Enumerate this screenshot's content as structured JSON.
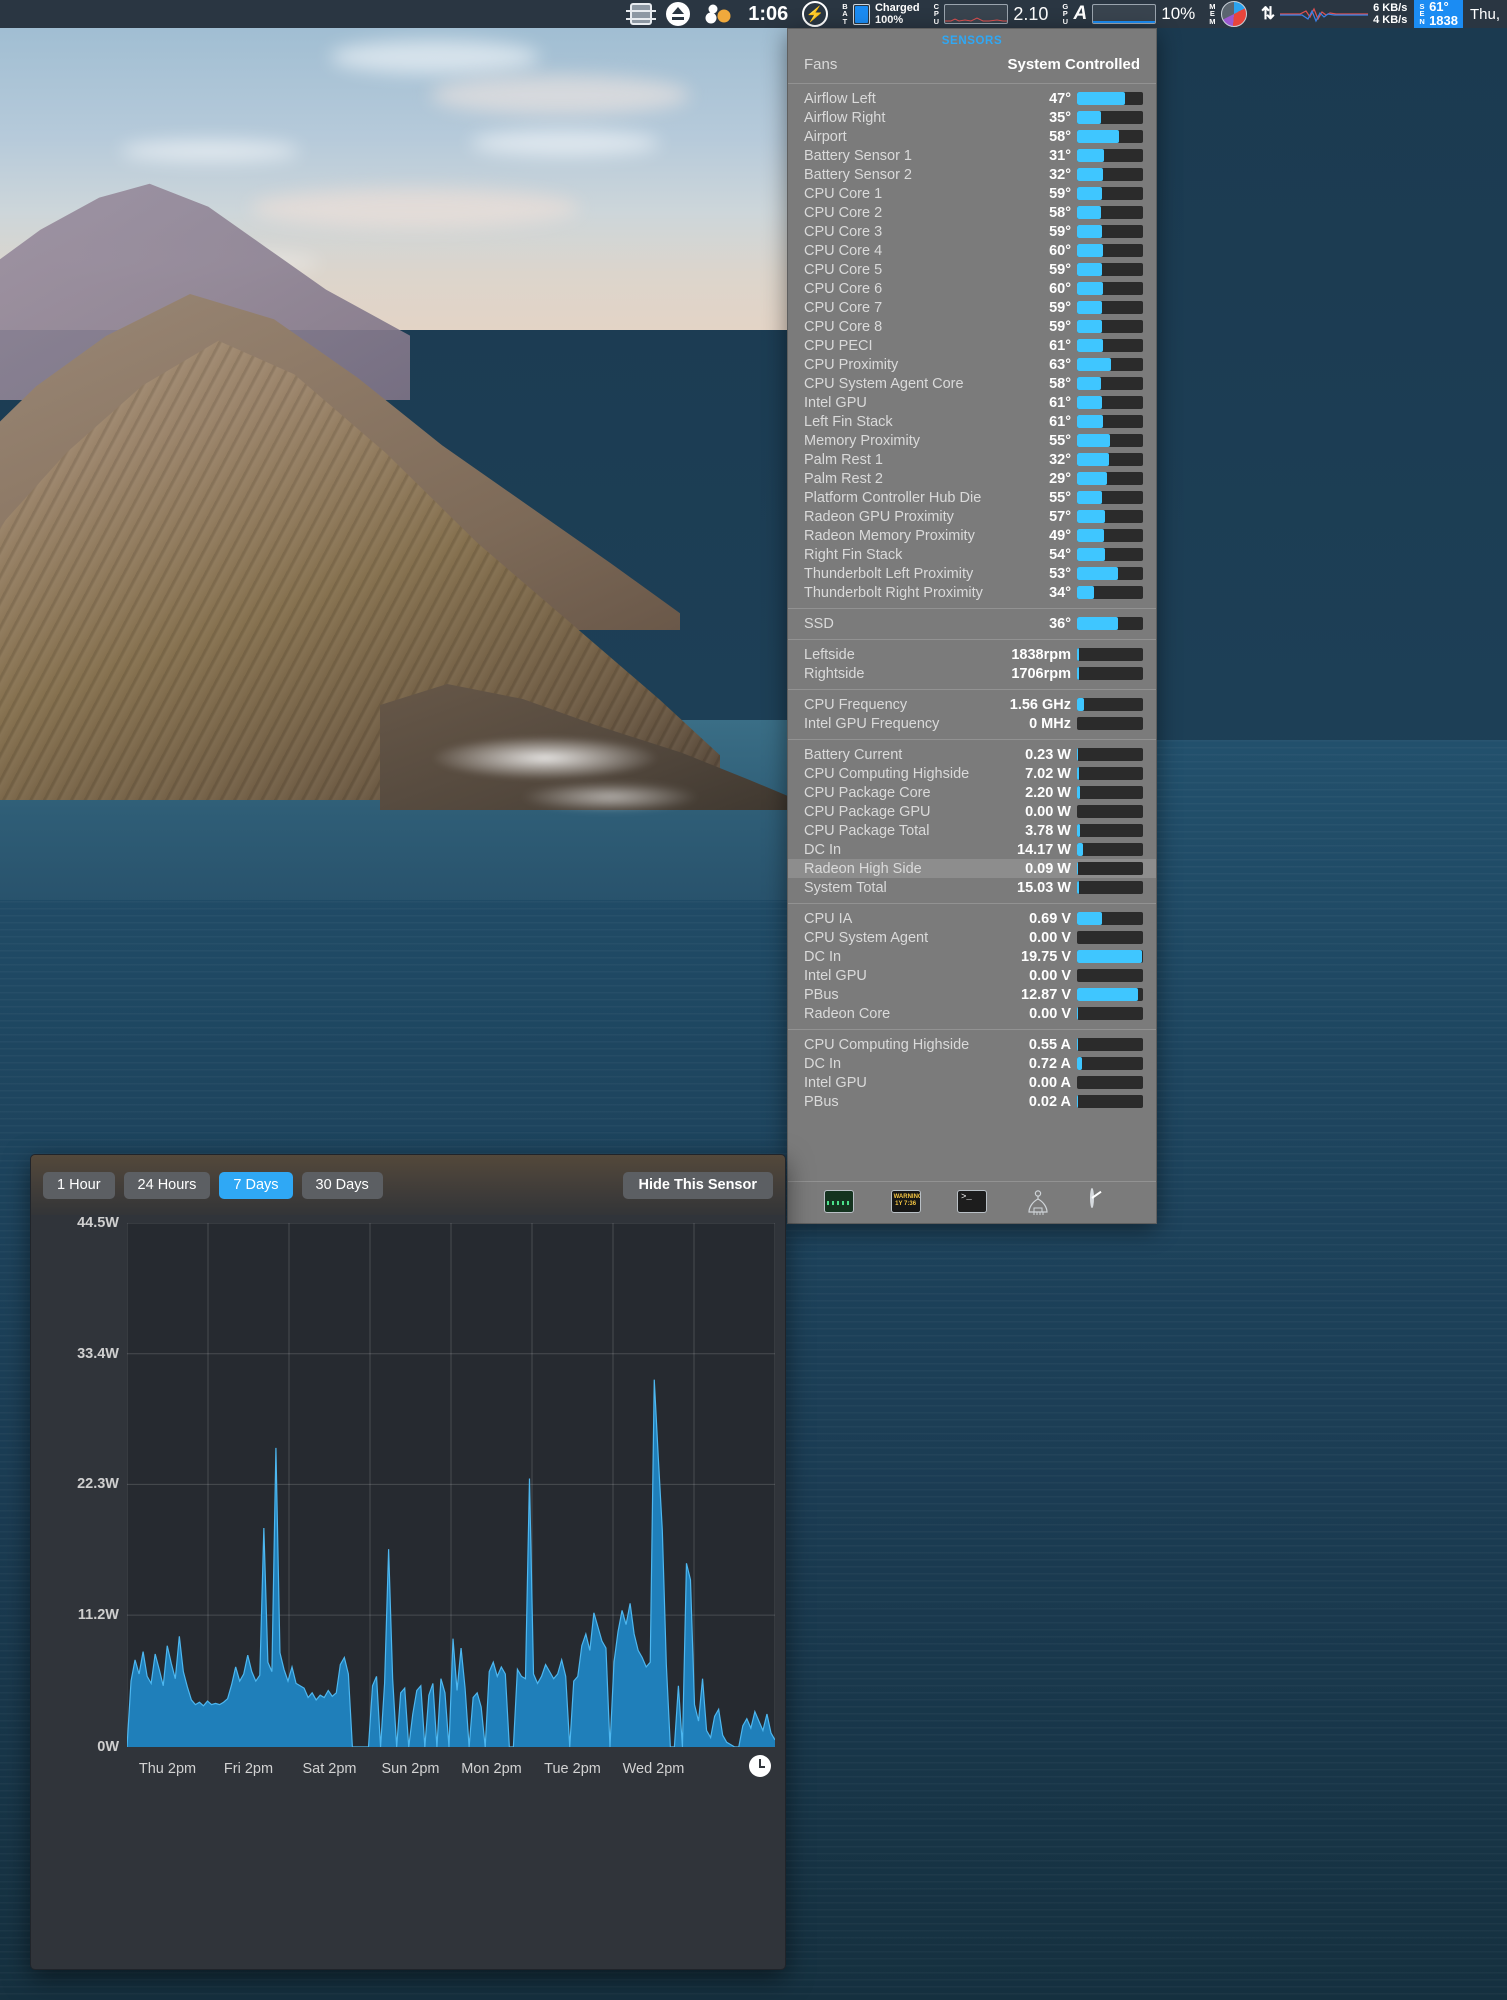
{
  "menubar": {
    "items": [
      {
        "name": "cpu-chip-indicator",
        "type": "icon",
        "label": ""
      },
      {
        "name": "eject-indicator",
        "type": "icon",
        "label": ""
      },
      {
        "name": "dots-indicator",
        "type": "icon",
        "label": ""
      },
      {
        "name": "clock",
        "type": "text",
        "label": "1:06"
      },
      {
        "name": "power-bolt",
        "type": "icon",
        "label": ""
      },
      {
        "name": "battery",
        "type": "stat",
        "prefix": "BAT",
        "line1": "Charged",
        "line2": "100%"
      },
      {
        "name": "cpu",
        "type": "stat",
        "prefix": "CPU",
        "value": "2.10"
      },
      {
        "name": "gpu",
        "type": "stat",
        "prefix": "GPU",
        "letter": "A",
        "value": "10%"
      },
      {
        "name": "mem",
        "type": "stat",
        "prefix": "MEM"
      },
      {
        "name": "network",
        "type": "stat",
        "line1": "6 KB/s",
        "line2": "4 KB/s"
      },
      {
        "name": "sensors-badge",
        "type": "stat",
        "prefix": "SEN",
        "line1": "61°",
        "line2": "1838"
      },
      {
        "name": "day",
        "type": "text",
        "label": "Thu,"
      }
    ],
    "clock": "1:06",
    "battery_status": "Charged",
    "battery_percent": "100%",
    "cpu_value": "2.10",
    "gpu_percent": "10%",
    "gpu_letter": "A",
    "net_up": "6 KB/s",
    "net_down": "4 KB/s",
    "sen_temp": "61°",
    "sen_rpm": "1838",
    "day": "Thu,",
    "labels": {
      "bat": "BAT",
      "cpu": "CPU",
      "gpu": "GPU",
      "mem": "MEM",
      "sen": "SEN"
    }
  },
  "panel": {
    "title": "SENSORS",
    "fans_label": "Fans",
    "fans_value": "System Controlled",
    "accent": "#2fa8f5",
    "bar_color": "#3fc6ff",
    "bar_bg": "#2b2b2b",
    "groups": [
      {
        "id": "temperatures",
        "rows": [
          {
            "name": "Airflow Left",
            "value": "47°",
            "pct": 72
          },
          {
            "name": "Airflow Right",
            "value": "35°",
            "pct": 36
          },
          {
            "name": "Airport",
            "value": "58°",
            "pct": 64
          },
          {
            "name": "Battery Sensor 1",
            "value": "31°",
            "pct": 41
          },
          {
            "name": "Battery Sensor 2",
            "value": "32°",
            "pct": 39
          },
          {
            "name": "CPU Core 1",
            "value": "59°",
            "pct": 38
          },
          {
            "name": "CPU Core 2",
            "value": "58°",
            "pct": 36
          },
          {
            "name": "CPU Core 3",
            "value": "59°",
            "pct": 38
          },
          {
            "name": "CPU Core 4",
            "value": "60°",
            "pct": 40
          },
          {
            "name": "CPU Core 5",
            "value": "59°",
            "pct": 38
          },
          {
            "name": "CPU Core 6",
            "value": "60°",
            "pct": 40
          },
          {
            "name": "CPU Core 7",
            "value": "59°",
            "pct": 38
          },
          {
            "name": "CPU Core 8",
            "value": "59°",
            "pct": 38
          },
          {
            "name": "CPU PECI",
            "value": "61°",
            "pct": 40
          },
          {
            "name": "CPU Proximity",
            "value": "63°",
            "pct": 51
          },
          {
            "name": "CPU System Agent Core",
            "value": "58°",
            "pct": 37
          },
          {
            "name": "Intel GPU",
            "value": "61°",
            "pct": 38
          },
          {
            "name": "Left Fin Stack",
            "value": "61°",
            "pct": 40
          },
          {
            "name": "Memory Proximity",
            "value": "55°",
            "pct": 50
          },
          {
            "name": "Palm Rest 1",
            "value": "32°",
            "pct": 48
          },
          {
            "name": "Palm Rest 2",
            "value": "29°",
            "pct": 45
          },
          {
            "name": "Platform Controller Hub Die",
            "value": "55°",
            "pct": 38
          },
          {
            "name": "Radeon GPU Proximity",
            "value": "57°",
            "pct": 43
          },
          {
            "name": "Radeon Memory Proximity",
            "value": "49°",
            "pct": 41
          },
          {
            "name": "Right Fin Stack",
            "value": "54°",
            "pct": 42
          },
          {
            "name": "Thunderbolt Left Proximity",
            "value": "53°",
            "pct": 62
          },
          {
            "name": "Thunderbolt Right Proximity",
            "value": "34°",
            "pct": 26
          }
        ]
      },
      {
        "id": "drive",
        "rows": [
          {
            "name": "SSD",
            "value": "36°",
            "pct": 62
          }
        ]
      },
      {
        "id": "fan-speeds",
        "rows": [
          {
            "name": "Leftside",
            "value": "1838rpm",
            "pct": 3
          },
          {
            "name": "Rightside",
            "value": "1706rpm",
            "pct": 3
          }
        ]
      },
      {
        "id": "frequencies",
        "rows": [
          {
            "name": "CPU Frequency",
            "value": "1.56 GHz",
            "pct": 11
          },
          {
            "name": "Intel GPU Frequency",
            "value": "0 MHz",
            "pct": 0
          }
        ]
      },
      {
        "id": "power",
        "rows": [
          {
            "name": "Battery Current",
            "value": "0.23 W",
            "pct": 2
          },
          {
            "name": "CPU Computing Highside",
            "value": "7.02 W",
            "pct": 3
          },
          {
            "name": "CPU Package Core",
            "value": "2.20 W",
            "pct": 4
          },
          {
            "name": "CPU Package GPU",
            "value": "0.00 W",
            "pct": 0
          },
          {
            "name": "CPU Package Total",
            "value": "3.78 W",
            "pct": 4
          },
          {
            "name": "DC In",
            "value": "14.17 W",
            "pct": 9
          },
          {
            "name": "Radeon High Side",
            "value": "0.09 W",
            "pct": 2,
            "highlight": true
          },
          {
            "name": "System Total",
            "value": "15.03 W",
            "pct": 3
          }
        ]
      },
      {
        "id": "voltage",
        "rows": [
          {
            "name": "CPU IA",
            "value": "0.69 V",
            "pct": 38
          },
          {
            "name": "CPU System Agent",
            "value": "0.00 V",
            "pct": 0
          },
          {
            "name": "DC In",
            "value": "19.75 V",
            "pct": 98
          },
          {
            "name": "Intel GPU",
            "value": "0.00 V",
            "pct": 0
          },
          {
            "name": "PBus",
            "value": "12.87 V",
            "pct": 92
          },
          {
            "name": "Radeon Core",
            "value": "0.00 V",
            "pct": 2
          }
        ]
      },
      {
        "id": "current",
        "rows": [
          {
            "name": "CPU Computing Highside",
            "value": "0.55 A",
            "pct": 2
          },
          {
            "name": "DC In",
            "value": "0.72 A",
            "pct": 8
          },
          {
            "name": "Intel GPU",
            "value": "0.00 A",
            "pct": 0
          },
          {
            "name": "PBus",
            "value": "0.02 A",
            "pct": 2
          }
        ]
      }
    ],
    "toolbar": [
      {
        "name": "activity-monitor-icon",
        "label": ""
      },
      {
        "name": "warning-log-icon",
        "label": "WARNING\n1Y 7:36"
      },
      {
        "name": "terminal-icon",
        "label": ">_"
      },
      {
        "name": "sensor-probe-icon",
        "label": ""
      },
      {
        "name": "gauge-preferences-icon",
        "label": ""
      }
    ]
  },
  "graph": {
    "range_buttons": [
      {
        "label": "1 Hour",
        "active": false
      },
      {
        "label": "24 Hours",
        "active": false
      },
      {
        "label": "7 Days",
        "active": true
      },
      {
        "label": "30 Days",
        "active": false
      }
    ],
    "hide_button": "Hide This Sensor",
    "accent": "#2fa8f5",
    "series_color": "#1f7fba",
    "line_color": "#4db7f0"
  },
  "chart_data": {
    "type": "area",
    "title": "",
    "xlabel": "",
    "ylabel": "",
    "unit": "W",
    "ylim": [
      0,
      44.5
    ],
    "yticks": [
      0,
      11.2,
      22.3,
      33.4,
      44.5
    ],
    "ytick_labels": [
      "0W",
      "11.2W",
      "22.3W",
      "33.4W",
      "44.5W"
    ],
    "xtick_labels": [
      "Thu 2pm",
      "Fri 2pm",
      "Sat 2pm",
      "Sun 2pm",
      "Mon 2pm",
      "Tue 2pm",
      "Wed 2pm"
    ],
    "grid": true,
    "legend": "none",
    "series": [
      {
        "name": "Radeon High Side Power",
        "values": [
          0.0,
          5.6,
          7.4,
          6.2,
          8.1,
          6.0,
          5.4,
          7.9,
          6.6,
          5.2,
          8.6,
          7.1,
          5.8,
          9.4,
          6.4,
          5.1,
          4.0,
          3.6,
          3.8,
          3.5,
          3.9,
          3.6,
          3.7,
          3.6,
          3.8,
          4.1,
          5.3,
          6.8,
          5.6,
          6.2,
          7.8,
          6.4,
          5.6,
          6.1,
          18.6,
          7.2,
          6.4,
          25.4,
          8.0,
          6.6,
          5.6,
          6.8,
          5.4,
          5.2,
          5.0,
          4.2,
          4.6,
          4.0,
          4.4,
          4.2,
          4.8,
          4.3,
          4.6,
          7.0,
          7.6,
          6.2,
          0.0,
          0.0,
          0.0,
          0.0,
          0.0,
          5.2,
          6.0,
          0.0,
          5.4,
          16.8,
          5.8,
          0.0,
          4.6,
          5.0,
          0.0,
          2.8,
          4.8,
          5.2,
          0.0,
          4.4,
          5.4,
          0.0,
          5.8,
          4.6,
          0.0,
          9.2,
          4.8,
          8.4,
          5.0,
          0.0,
          4.2,
          4.6,
          3.4,
          0.0,
          6.4,
          7.2,
          6.0,
          6.8,
          6.2,
          0.0,
          0.0,
          6.6,
          6.0,
          5.8,
          22.8,
          6.2,
          5.4,
          6.0,
          7.0,
          6.4,
          5.8,
          6.2,
          7.4,
          6.0,
          0.0,
          5.6,
          6.0,
          8.6,
          9.6,
          8.2,
          11.4,
          10.2,
          9.0,
          8.4,
          0.0,
          7.2,
          9.8,
          11.6,
          10.4,
          12.2,
          9.6,
          8.2,
          7.6,
          6.8,
          7.2,
          31.2,
          24.6,
          18.4,
          7.0,
          0.0,
          0.0,
          5.2,
          0.0,
          15.6,
          14.2,
          3.6,
          2.2,
          5.8,
          1.4,
          0.8,
          2.6,
          3.2,
          1.0,
          0.4,
          0.2,
          0.0,
          0.0,
          1.8,
          2.4,
          1.6,
          3.0,
          2.2,
          1.4,
          2.8,
          1.2,
          0.6
        ]
      }
    ]
  }
}
